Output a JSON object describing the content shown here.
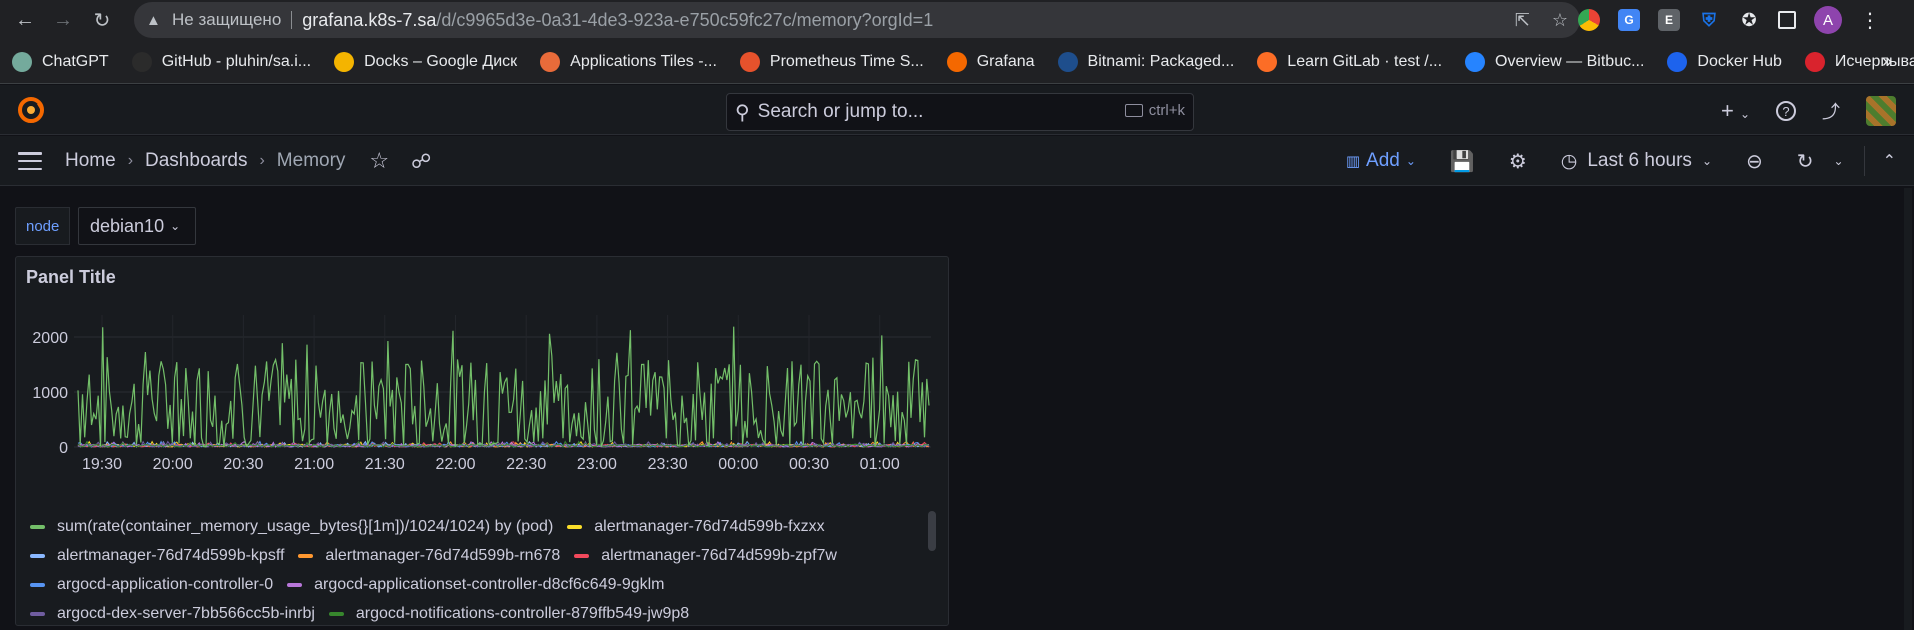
{
  "browser": {
    "insecure_label": "Не защищено",
    "url_host": "grafana.k8s-7.sa",
    "url_path": "/d/c9965d3e-0a31-4de3-923a-e750c59fc27c/memory?orgId=1",
    "profile_letter": "A",
    "bookmarks": [
      {
        "label": "ChatGPT",
        "color": "#74aa9c"
      },
      {
        "label": "GitHub - pluhin/sa.i...",
        "color": "#2b2b2b"
      },
      {
        "label": "Docks – Google Диск",
        "color": "#f4b400"
      },
      {
        "label": "Applications Tiles -...",
        "color": "#e86b3a"
      },
      {
        "label": "Prometheus Time S...",
        "color": "#e6522c"
      },
      {
        "label": "Grafana",
        "color": "#f46800"
      },
      {
        "label": "Bitnami: Packaged...",
        "color": "#1e4e8c"
      },
      {
        "label": "Learn GitLab · test /...",
        "color": "#fc6d26"
      },
      {
        "label": "Overview — Bitbuc...",
        "color": "#2684ff"
      },
      {
        "label": "Docker Hub",
        "color": "#1d63ed"
      },
      {
        "label": "Исчерпывающая...",
        "color": "#d9232d"
      }
    ],
    "bookmarks_more": "»"
  },
  "grafana": {
    "search_placeholder": "Search or jump to...",
    "search_shortcut": "ctrl+k",
    "breadcrumb": [
      "Home",
      "Dashboards",
      "Memory"
    ],
    "add_label": "Add",
    "time_range": "Last 6 hours",
    "variable": {
      "name": "node",
      "value": "debian10"
    }
  },
  "panel": {
    "title": "Panel Title"
  },
  "chart_data": {
    "type": "line",
    "title": "Panel Title",
    "xlabel": "",
    "ylabel": "",
    "ylim": [
      0,
      2400
    ],
    "yticks": [
      0,
      1000,
      2000
    ],
    "xticks": [
      "19:30",
      "20:00",
      "20:30",
      "21:00",
      "21:30",
      "22:00",
      "22:30",
      "23:00",
      "23:30",
      "00:00",
      "00:30",
      "01:00"
    ],
    "grid": true,
    "legend_position": "bottom",
    "series": [
      {
        "name": "sum(rate(container_memory_usage_bytes{}[1m])/1024/1024) by (pod)",
        "color": "#73bf69",
        "approx_range": [
          0,
          2200
        ],
        "typical": 1000
      },
      {
        "name": "alertmanager-76d74d599b-fxzxx",
        "color": "#fade2a",
        "approx_range": [
          0,
          100
        ]
      },
      {
        "name": "alertmanager-76d74d599b-kpsff",
        "color": "#8ab8ff",
        "approx_range": [
          0,
          100
        ]
      },
      {
        "name": "alertmanager-76d74d599b-rn678",
        "color": "#ff9830",
        "approx_range": [
          0,
          100
        ]
      },
      {
        "name": "alertmanager-76d74d599b-zpf7w",
        "color": "#f2495c",
        "approx_range": [
          0,
          100
        ]
      },
      {
        "name": "argocd-application-controller-0",
        "color": "#5794f2",
        "approx_range": [
          0,
          100
        ]
      },
      {
        "name": "argocd-applicationset-controller-d8cf6c649-9gklm",
        "color": "#b877d9",
        "approx_range": [
          0,
          100
        ]
      },
      {
        "name": "argocd-dex-server-7bb566cc5b-inrbj",
        "color": "#705da0",
        "approx_range": [
          0,
          100
        ]
      },
      {
        "name": "argocd-notifications-controller-879ffb549-jw9p8",
        "color": "#37872d",
        "approx_range": [
          0,
          100
        ]
      }
    ]
  }
}
